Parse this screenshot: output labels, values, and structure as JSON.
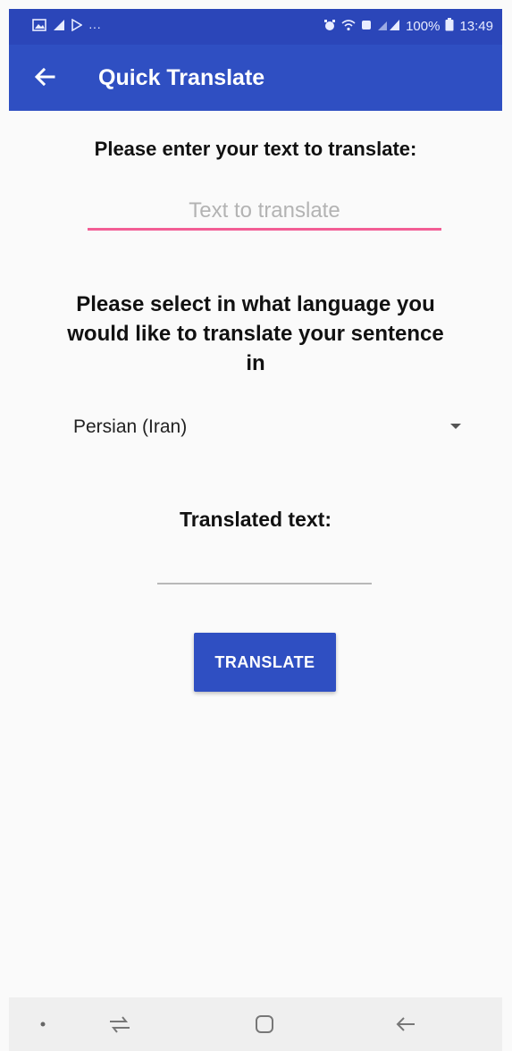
{
  "status_bar": {
    "left_icons": [
      "gallery-icon",
      "notification-icon",
      "play-store-icon",
      "more-icon"
    ],
    "right_icons": [
      "alarm-icon",
      "wifi-icon",
      "data-icon",
      "signal-icon"
    ],
    "battery": "100%",
    "time": "13:49"
  },
  "app_bar": {
    "title": "Quick Translate",
    "back_icon": "arrow-back-icon"
  },
  "form": {
    "prompt": "Please enter your text to translate:",
    "input_placeholder": "Text to translate",
    "input_value": "",
    "language_prompt": "Please select in what language you would like to translate your sentence in",
    "selected_language": "Persian (Iran)",
    "output_label": "Translated text:",
    "output_value": "",
    "translate_button": "TRANSLATE"
  },
  "nav_bar": {
    "items": [
      "dot-icon",
      "recents-icon",
      "home-icon",
      "back-icon"
    ]
  },
  "colors": {
    "primary": "#2f4fc2",
    "status_bar": "#2b46b9",
    "accent": "#f25d94",
    "background": "#fafafa"
  }
}
